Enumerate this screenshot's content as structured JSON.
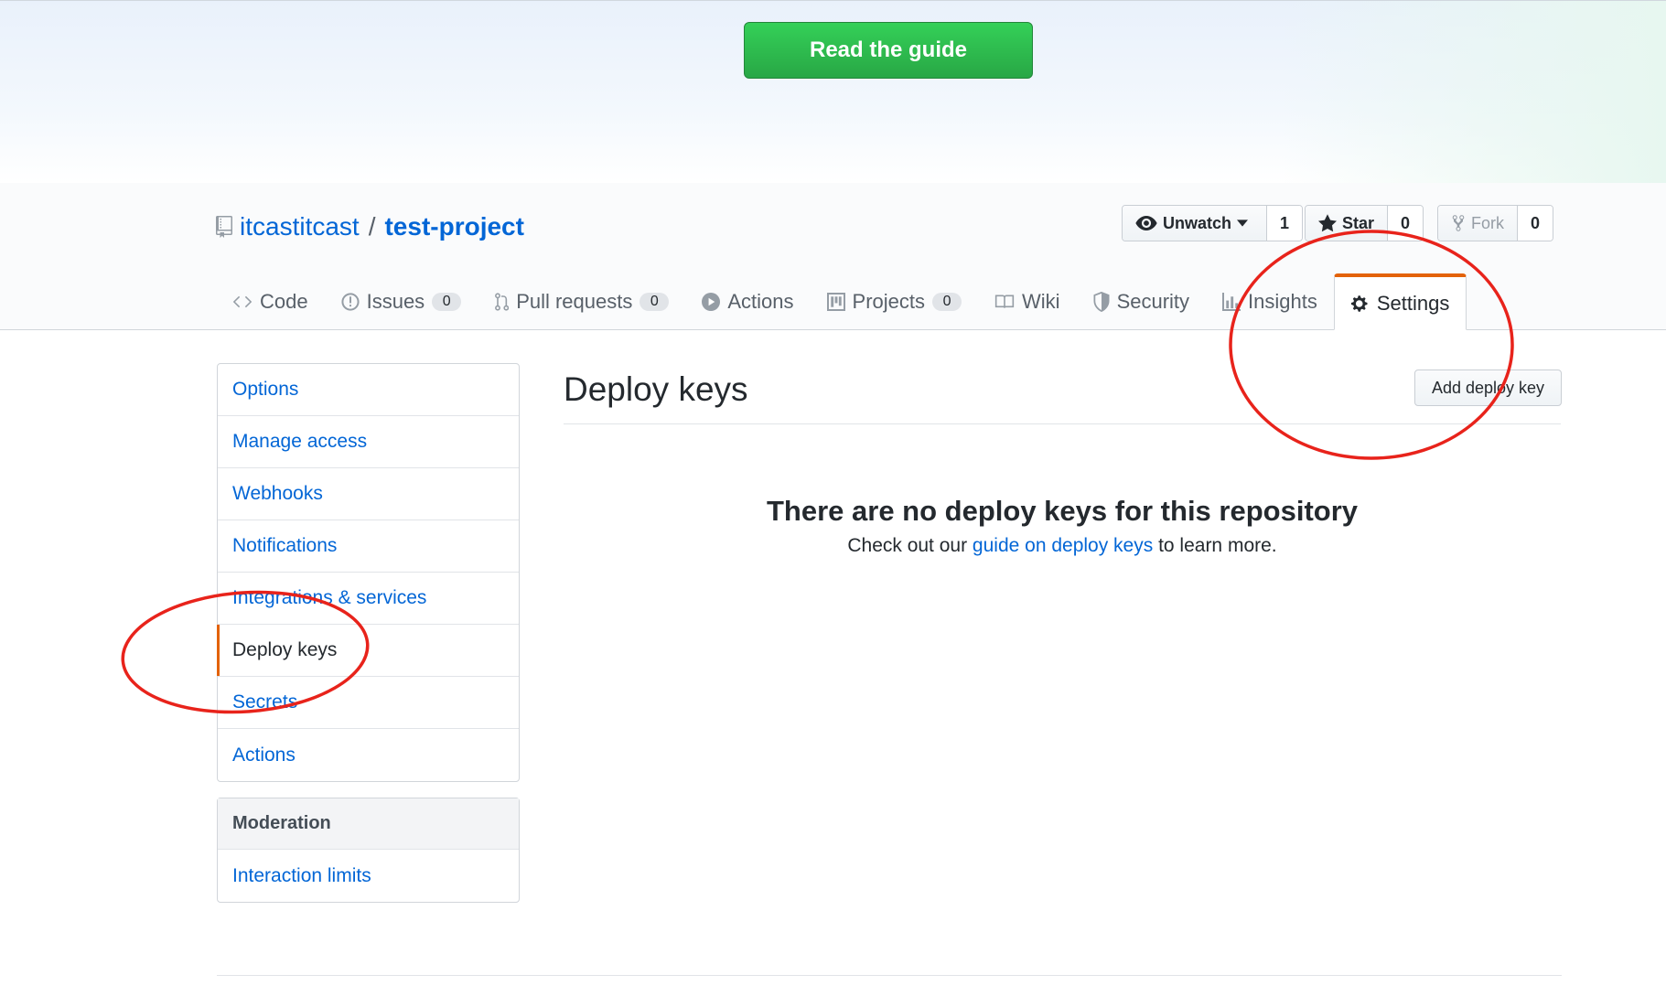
{
  "banner": {
    "guide_button": "Read the guide"
  },
  "repo": {
    "owner": "itcastitcast",
    "separator": "/",
    "name": "test-project"
  },
  "actions": {
    "watch": {
      "label": "Unwatch",
      "count": "1"
    },
    "star": {
      "label": "Star",
      "count": "0"
    },
    "fork": {
      "label": "Fork",
      "count": "0"
    }
  },
  "tabs": [
    {
      "label": "Code"
    },
    {
      "label": "Issues",
      "count": "0"
    },
    {
      "label": "Pull requests",
      "count": "0"
    },
    {
      "label": "Actions"
    },
    {
      "label": "Projects",
      "count": "0"
    },
    {
      "label": "Wiki"
    },
    {
      "label": "Security"
    },
    {
      "label": "Insights"
    },
    {
      "label": "Settings",
      "selected": true
    }
  ],
  "sidebar": {
    "items": [
      {
        "label": "Options"
      },
      {
        "label": "Manage access"
      },
      {
        "label": "Webhooks"
      },
      {
        "label": "Notifications"
      },
      {
        "label": "Integrations & services"
      },
      {
        "label": "Deploy keys",
        "selected": true
      },
      {
        "label": "Secrets"
      },
      {
        "label": "Actions"
      }
    ],
    "moderation": {
      "heading": "Moderation",
      "items": [
        {
          "label": "Interaction limits"
        }
      ]
    }
  },
  "main": {
    "title": "Deploy keys",
    "add_button": "Add deploy key",
    "blank_title": "There are no deploy keys for this repository",
    "blank_prefix": "Check out our ",
    "blank_link": "guide on deploy keys",
    "blank_suffix": " to learn more."
  },
  "colors": {
    "link": "#0366d6",
    "accent_orange": "#e36209",
    "primary_green": "#28a745",
    "annotation_red": "#e8231b"
  }
}
